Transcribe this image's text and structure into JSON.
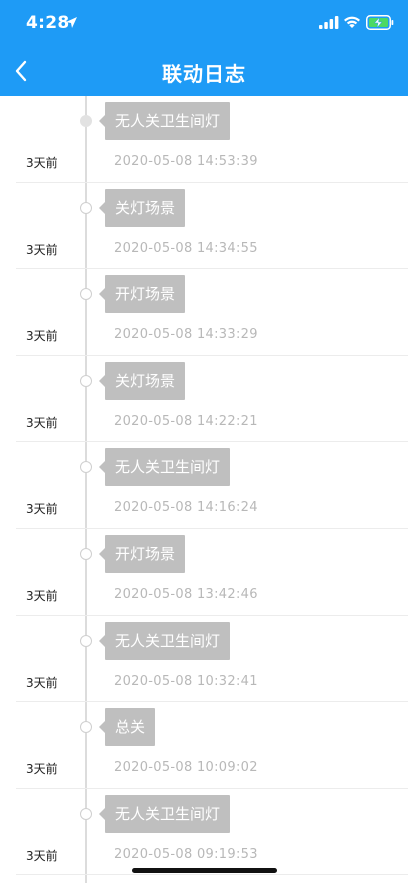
{
  "status_bar": {
    "time": "4:28"
  },
  "nav": {
    "title": "联动日志"
  },
  "logs": [
    {
      "relative": "3天前",
      "scene": "无人关卫生间灯",
      "timestamp": "2020-05-08 14:53:39"
    },
    {
      "relative": "3天前",
      "scene": "关灯场景",
      "timestamp": "2020-05-08 14:34:55"
    },
    {
      "relative": "3天前",
      "scene": "开灯场景",
      "timestamp": "2020-05-08 14:33:29"
    },
    {
      "relative": "3天前",
      "scene": "关灯场景",
      "timestamp": "2020-05-08 14:22:21"
    },
    {
      "relative": "3天前",
      "scene": "无人关卫生间灯",
      "timestamp": "2020-05-08 14:16:24"
    },
    {
      "relative": "3天前",
      "scene": "开灯场景",
      "timestamp": "2020-05-08 13:42:46"
    },
    {
      "relative": "3天前",
      "scene": "无人关卫生间灯",
      "timestamp": "2020-05-08 10:32:41"
    },
    {
      "relative": "3天前",
      "scene": "总关",
      "timestamp": "2020-05-08 10:09:02"
    },
    {
      "relative": "3天前",
      "scene": "无人关卫生间灯",
      "timestamp": "2020-05-08 09:19:53"
    }
  ],
  "colors": {
    "header_bg": "#1e9bf6",
    "bubble_bg": "#bfbfbf",
    "timestamp_text": "#b8b8b8",
    "battery_charging": "#4cd964"
  },
  "icons": {
    "back": "chevron-left-icon",
    "location": "location-arrow-icon",
    "signal": "cellular-signal-icon",
    "wifi": "wifi-icon",
    "battery": "battery-charging-icon"
  }
}
